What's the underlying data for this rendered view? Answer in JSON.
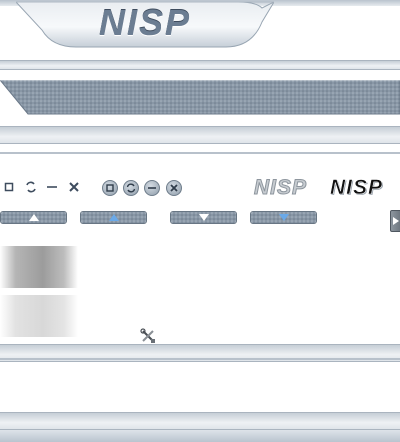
{
  "header": {
    "logo_text": "NISP"
  },
  "window_controls": {
    "plain": [
      {
        "icon": "maximize-icon"
      },
      {
        "icon": "restore-icon"
      },
      {
        "icon": "minimize-icon"
      },
      {
        "icon": "close-icon"
      }
    ],
    "round": [
      {
        "icon": "maximize-icon"
      },
      {
        "icon": "restore-icon"
      },
      {
        "icon": "minimize-icon"
      },
      {
        "icon": "close-icon"
      }
    ]
  },
  "logos": {
    "grey_logo_text": "NISP",
    "black_logo_text": "NISP"
  },
  "scroll_buttons": [
    {
      "icon": "arrow-up-icon",
      "arrow_color": "#ffffff"
    },
    {
      "icon": "arrow-up-icon",
      "arrow_color": "#6aa9e8"
    },
    {
      "icon": "arrow-down-icon",
      "arrow_color": "#ffffff"
    },
    {
      "icon": "arrow-down-icon",
      "arrow_color": "#6aa9e8"
    }
  ],
  "colors": {
    "accent_blue": "#6aa9e8",
    "frame_grey": "#aab4bf",
    "logo_steel": "#6b7d92"
  }
}
